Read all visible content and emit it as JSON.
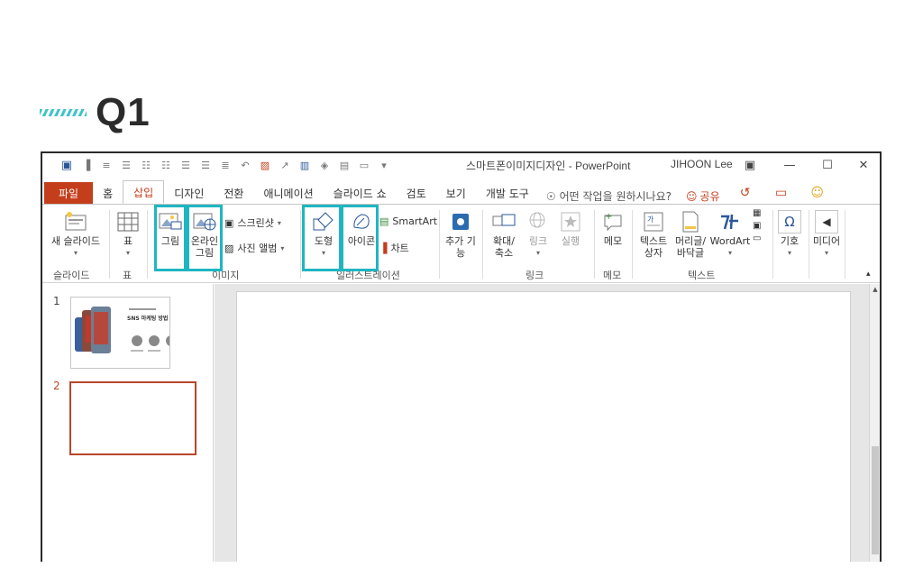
{
  "heading": {
    "title": "Q1"
  },
  "window": {
    "doc_title": "스마트폰이미지디자인 - PowerPoint",
    "user": "JIHOON Lee"
  },
  "tabs": [
    {
      "label": "파일"
    },
    {
      "label": "홈"
    },
    {
      "label": "삽입"
    },
    {
      "label": "디자인"
    },
    {
      "label": "전환"
    },
    {
      "label": "애니메이션"
    },
    {
      "label": "슬라이드 쇼"
    },
    {
      "label": "검토"
    },
    {
      "label": "보기"
    },
    {
      "label": "개발 도구"
    }
  ],
  "tell_me": "어떤 작업을 원하시나요?",
  "share": "공유",
  "ribbon": {
    "new_slide": {
      "label": "새 슬라이드"
    },
    "table": {
      "label": "표"
    },
    "picture": {
      "label": "그림"
    },
    "online_picture": {
      "line1": "온라인",
      "line2": "그림"
    },
    "screenshot": {
      "label": "스크린샷"
    },
    "photo_album": {
      "label": "사진 앨범"
    },
    "shapes": {
      "label": "도형"
    },
    "icons": {
      "label": "아이콘"
    },
    "smartart": {
      "label": "SmartArt"
    },
    "chart": {
      "label": "차트"
    },
    "addins": {
      "line1": "추가 기",
      "line2": "능"
    },
    "zoom": {
      "line1": "확대/",
      "line2": "축소"
    },
    "link": {
      "label": "링크"
    },
    "action": {
      "label": "실행"
    },
    "comment": {
      "label": "메모"
    },
    "textbox": {
      "line1": "텍스트",
      "line2": "상자"
    },
    "header_footer": {
      "line1": "머리글/",
      "line2": "바닥글"
    },
    "wordart": {
      "label": "WordArt"
    },
    "symbols": {
      "label": "기호"
    },
    "media": {
      "label": "미디어"
    },
    "groups": {
      "slides": "슬라이드",
      "tables": "표",
      "images": "이미지",
      "illustrations": "일러스트레이션",
      "links": "링크",
      "comments": "메모",
      "text": "텍스트"
    }
  },
  "slides": [
    {
      "number": "1",
      "thumb_title": "SNS 마케팅 방법 예시"
    },
    {
      "number": "2"
    }
  ]
}
